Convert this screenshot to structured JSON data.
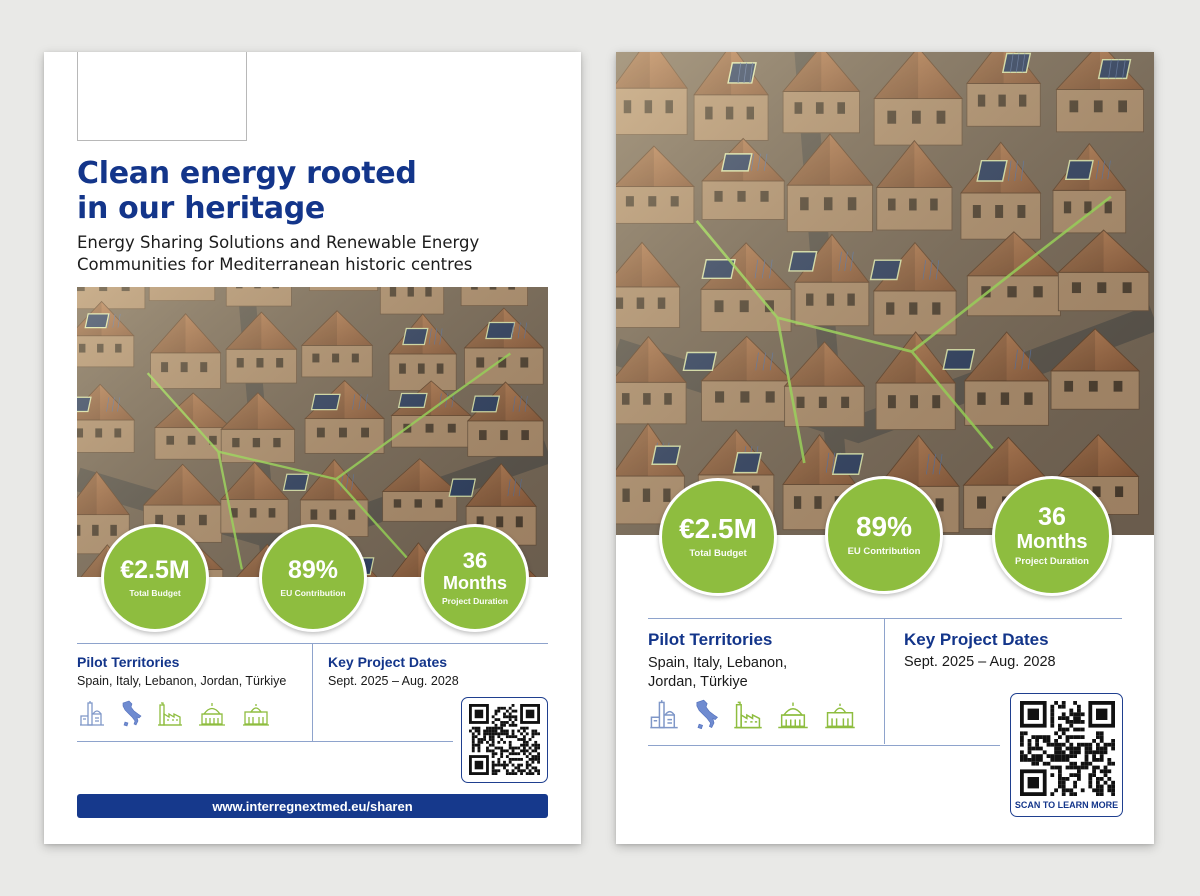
{
  "left_poster": {
    "title_line1": "Clean energy rooted",
    "title_line2": "in our heritage",
    "subtitle_line1": "Energy Sharing Solutions and Renewable Energy",
    "subtitle_line2": "Communities for Mediterranean historic centres",
    "stats": [
      {
        "value": "€2.5M",
        "label": "Total Budget"
      },
      {
        "value": "89%",
        "label": "EU Contribution"
      },
      {
        "value_line1": "36",
        "value_line2": "Months",
        "label": "Project Duration"
      }
    ],
    "pilot": {
      "title": "Pilot Territories",
      "text": "Spain, Italy, Lebanon, Jordan, Türkiye"
    },
    "dates": {
      "title": "Key Project Dates",
      "text": "Sept. 2025 – Aug. 2028"
    },
    "url": "www.interregnextmed.eu/sharen"
  },
  "right_poster": {
    "stats": [
      {
        "value": "€2.5M",
        "label": "Total Budget"
      },
      {
        "value": "89%",
        "label": "EU Contribution"
      },
      {
        "value_line1": "36",
        "value_line2": "Months",
        "label": "Project Duration"
      }
    ],
    "pilot": {
      "title": "Pilot Territories",
      "text_line1": "Spain, Italy, Lebanon,",
      "text_line2": "Jordan, Türkiye"
    },
    "dates": {
      "title": "Key Project Dates",
      "text": "Sept. 2025 – Aug. 2028"
    },
    "qr_caption": "SCAN TO LEARN MORE"
  },
  "icons": [
    "landmark-church-icon",
    "italy-map-icon",
    "factory-icon",
    "mosque-dome-icon",
    "palace-icon"
  ],
  "colors": {
    "brand_blue": "#13358a",
    "accent_green": "#8ebd3f",
    "url_bar": "#16398c",
    "divider": "#8ea3cc"
  }
}
